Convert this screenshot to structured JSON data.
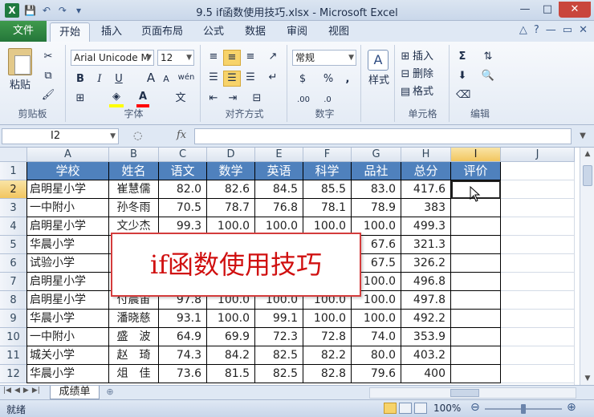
{
  "window": {
    "title": "9.5 if函数使用技巧.xlsx - Microsoft Excel",
    "app_icon": "X",
    "minimize": "—",
    "maximize": "□",
    "close": "✕"
  },
  "qat": {
    "save": "💾",
    "undo": "↶",
    "redo": "↷",
    "customize": "▾"
  },
  "ribbon_tabs": [
    "文件",
    "开始",
    "插入",
    "页面布局",
    "公式",
    "数据",
    "审阅",
    "视图"
  ],
  "active_tab": "开始",
  "ribbon_right": {
    "minimize_ribbon": "△",
    "help": "?",
    "min": "—",
    "restore": "▭",
    "close": "✕"
  },
  "clipboard": {
    "paste": "粘贴",
    "label": "剪贴板"
  },
  "font": {
    "name": "Arial Unicode M",
    "size": "12",
    "bold": "B",
    "italic": "I",
    "underline": "U",
    "grow": "A",
    "shrink": "A",
    "wen": "wén",
    "label": "字体",
    "fill_color": "#ffff00",
    "font_color": "#ff0000"
  },
  "alignment": {
    "label": "对齐方式"
  },
  "number": {
    "format": "常规",
    "currency": "$",
    "percent": "%",
    "comma": ",",
    "label": "数字"
  },
  "styles": {
    "label": "样式"
  },
  "cells": {
    "insert": "插入",
    "delete": "删除",
    "format": "格式",
    "label": "单元格"
  },
  "editing": {
    "sum": "Σ",
    "label": "编辑"
  },
  "formula_bar": {
    "name_box": "I2",
    "fx": "fx",
    "formula": ""
  },
  "columns": [
    "A",
    "B",
    "C",
    "D",
    "E",
    "F",
    "G",
    "H",
    "I",
    "J"
  ],
  "rows": [
    "1",
    "2",
    "3",
    "4",
    "5",
    "6",
    "7",
    "8",
    "9",
    "10",
    "11",
    "12"
  ],
  "table": {
    "header": [
      "学校",
      "姓名",
      "语文",
      "数学",
      "英语",
      "科学",
      "品社",
      "总分",
      "评价"
    ],
    "body": [
      [
        "启明星小学",
        "崔慧儒",
        "82.0",
        "82.6",
        "84.5",
        "85.5",
        "83.0",
        "417.6",
        ""
      ],
      [
        "一中附小",
        "孙冬雨",
        "70.5",
        "78.7",
        "76.8",
        "78.1",
        "78.9",
        "383",
        ""
      ],
      [
        "启明星小学",
        "文少杰",
        "99.3",
        "100.0",
        "100.0",
        "100.0",
        "100.0",
        "499.3",
        ""
      ],
      [
        "华晨小学",
        "",
        "",
        "",
        "",
        "",
        "67.6",
        "321.3",
        ""
      ],
      [
        "试验小学",
        "",
        "",
        "",
        "",
        "",
        "67.5",
        "326.2",
        ""
      ],
      [
        "启明星小学",
        "",
        "",
        "",
        "",
        "",
        "100.0",
        "496.8",
        ""
      ],
      [
        "启明星小学",
        "付晨宙",
        "97.8",
        "100.0",
        "100.0",
        "100.0",
        "100.0",
        "497.8",
        ""
      ],
      [
        "华晨小学",
        "潘晓慈",
        "93.1",
        "100.0",
        "99.1",
        "100.0",
        "100.0",
        "492.2",
        ""
      ],
      [
        "一中附小",
        "盛　波",
        "64.9",
        "69.9",
        "72.3",
        "72.8",
        "74.0",
        "353.9",
        ""
      ],
      [
        "城关小学",
        "赵　琦",
        "74.3",
        "84.2",
        "82.5",
        "82.2",
        "80.0",
        "403.2",
        ""
      ],
      [
        "华晨小学",
        "俎　佳",
        "73.6",
        "81.5",
        "82.5",
        "82.8",
        "79.6",
        "400",
        ""
      ]
    ]
  },
  "overlay_caption": "if函数使用技巧",
  "sheet_tab": "成绩单",
  "status": {
    "text": "就绪",
    "zoom": "100%",
    "zoom_level": 1.0
  },
  "colors": {
    "header_fill": "#4f81bd",
    "file_tab": "#2e7d3a",
    "overlay_border": "#d43c3c",
    "overlay_text": "#d01010"
  }
}
